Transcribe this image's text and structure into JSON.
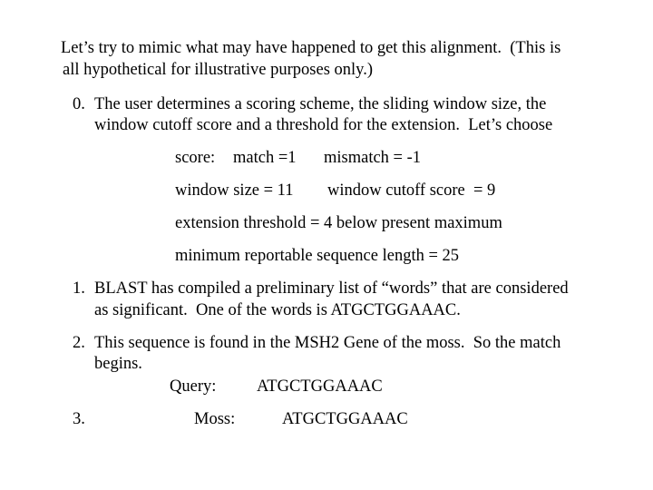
{
  "intro": {
    "line1": "Let’s try to mimic what may have happened to get this alignment.  (This is",
    "line2": "all hypothetical for illustrative purposes only.)"
  },
  "steps": [
    {
      "number": "0.",
      "lines": [
        "The user determines a scoring scheme, the sliding window size, the",
        "window cutoff score and a threshold for the extension.  Let’s choose"
      ]
    },
    {
      "number": "1.",
      "lines": [
        "BLAST has compiled a preliminary list of “words” that are considered",
        "as significant.  One of the words is ATGCTGGAAAC."
      ]
    },
    {
      "number": "2.",
      "lines": [
        "This sequence is found in the MSH2 Gene of the moss.  So the match",
        "begins."
      ]
    },
    {
      "number": "3.",
      "lines": []
    }
  ],
  "parameters": {
    "score_label": "score:",
    "match": "match =1",
    "mismatch": "mismatch = -1",
    "window_size": "window size = 11",
    "window_cutoff": "window cutoff score  = 9",
    "extension_threshold": "extension threshold = 4 below present maximum",
    "min_length": "minimum reportable sequence length = 25"
  },
  "alignment": {
    "query_label": "Query:",
    "query_seq": "ATGCTGGAAAC",
    "moss_label": "Moss:",
    "moss_seq": "ATGCTGGAAAC"
  }
}
